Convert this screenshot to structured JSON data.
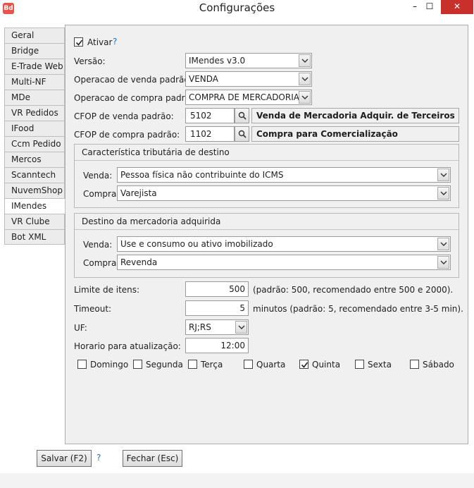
{
  "window": {
    "title": "Configurações",
    "app_icon_text": "Bd",
    "minimize": "–",
    "maximize": "☐",
    "close": "✕"
  },
  "tabs": [
    "Geral",
    "Bridge",
    "E-Trade Web",
    "Multi-NF",
    "MDe",
    "VR Pedidos",
    "IFood",
    "Ccm Pedido",
    "Mercos",
    "Scanntech",
    "NuvemShop",
    "IMendes",
    "VR Clube",
    "Bot XML"
  ],
  "active_tab": "IMendes",
  "form": {
    "ativar_label": "Ativar",
    "ativar_checked": true,
    "help": "?",
    "versao_label": "Versão:",
    "versao_value": "IMendes v3.0",
    "op_venda_label": "Operacao de venda padrão:",
    "op_venda_value": "VENDA",
    "op_compra_label": "Operacao de compra padrão:",
    "op_compra_value": "COMPRA DE MERCADORIA",
    "cfop_venda_label": "CFOP de venda padrão:",
    "cfop_venda_value": "5102",
    "cfop_venda_desc": "Venda de Mercadoria Adquir. de Terceiros",
    "cfop_compra_label": "CFOP de compra padrão:",
    "cfop_compra_value": "1102",
    "cfop_compra_desc": "Compra para Comercialização"
  },
  "group_tributaria": {
    "title": "Característica tributária de destino",
    "venda_label": "Venda:",
    "venda_value": "Pessoa física não contribuinte do ICMS",
    "compra_label": "Compra:",
    "compra_value": "Varejista"
  },
  "group_destino": {
    "title": "Destino da mercadoria adquirida",
    "venda_label": "Venda:",
    "venda_value": "Use e consumo ou ativo imobilizado",
    "compra_label": "Compra:",
    "compra_value": "Revenda"
  },
  "limits": {
    "limite_label": "Limite de itens:",
    "limite_value": "500",
    "limite_hint": "(padrão: 500, recomendado entre 500 e 2000).",
    "timeout_label": "Timeout:",
    "timeout_value": "5",
    "timeout_hint": "minutos (padrão: 5, recomendado entre 3-5 min).",
    "uf_label": "UF:",
    "uf_value": "RJ;RS",
    "horario_label": "Horario para atualização:",
    "horario_value": "12:00"
  },
  "days": [
    {
      "label": "Domingo",
      "checked": false
    },
    {
      "label": "Segunda",
      "checked": false
    },
    {
      "label": "Terça",
      "checked": false
    },
    {
      "label": "Quarta",
      "checked": false
    },
    {
      "label": "Quinta",
      "checked": true
    },
    {
      "label": "Sexta",
      "checked": false
    },
    {
      "label": "Sábado",
      "checked": false
    }
  ],
  "buttons": {
    "salvar": "Salvar (F2)",
    "fechar": "Fechar (Esc)"
  }
}
